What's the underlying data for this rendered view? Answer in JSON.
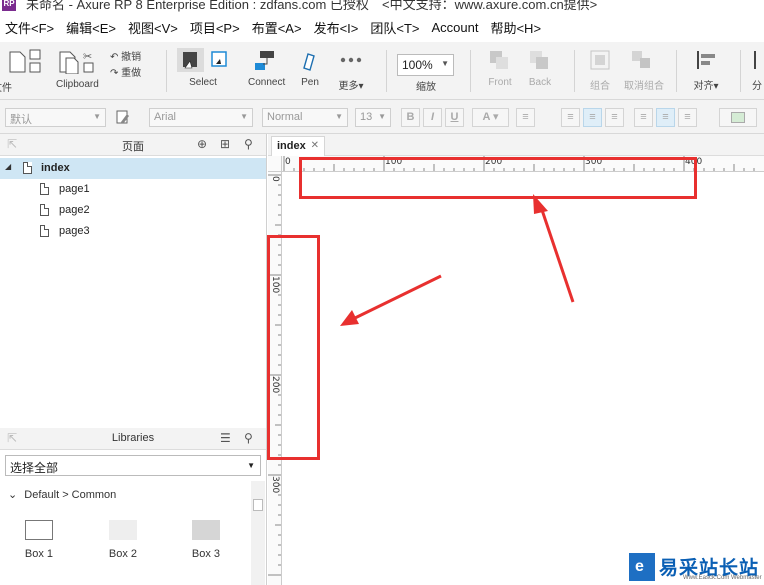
{
  "titlebar": {
    "app_icon": "RP",
    "title": "未命名 - Axure RP 8 Enterprise Edition : zdfans.com 已授权",
    "support": "<中文支持：www.axure.com.cn提供>"
  },
  "menu": [
    "文件<F>",
    "编辑<E>",
    "视图<V>",
    "项目<P>",
    "布置<A>",
    "发布<I>",
    "团队<T>",
    "Account",
    "帮助<H>"
  ],
  "toolbar": {
    "file": "文件",
    "clipboard": "Clipboard",
    "undo": "撤销",
    "redo": "重做",
    "select": "Select",
    "connect": "Connect",
    "pen": "Pen",
    "more": "更多▾",
    "zoom_value": "100%",
    "zoom_label": "缩放",
    "front": "Front",
    "back": "Back",
    "group": "组合",
    "ungroup": "取消组合",
    "align": "对齐▾",
    "distribute": "分"
  },
  "formatbar": {
    "style": "默认",
    "font": "Arial",
    "weight": "Normal",
    "size": "13"
  },
  "pages_panel": {
    "title": "页面",
    "root": "index",
    "pages": [
      "page1",
      "page2",
      "page3"
    ]
  },
  "libraries_panel": {
    "title": "Libraries",
    "selected_library": "选择全部",
    "group": "Default > Common",
    "items": [
      {
        "label": "Box 1",
        "fill": "#ffffff",
        "border": "#777777"
      },
      {
        "label": "Box 2",
        "fill": "#eeeeee",
        "border": "#eeeeee"
      },
      {
        "label": "Box 3",
        "fill": "#d6d6d6",
        "border": "#d6d6d6"
      }
    ]
  },
  "canvas": {
    "tab": "index",
    "hruler_labels": [
      "0",
      "100",
      "200",
      "300",
      "400"
    ],
    "vruler_labels": [
      "0",
      "100",
      "200",
      "300"
    ]
  },
  "annotation": {
    "color": "#e8302f"
  },
  "watermark": {
    "cn": "易采站长站",
    "en": "Www.Easck.Com Webmaster"
  }
}
